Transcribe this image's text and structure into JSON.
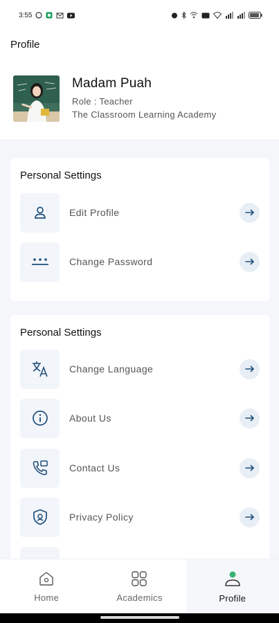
{
  "status_bar": {
    "time": "3:55",
    "left_icons": [
      "whatsapp-icon",
      "app-badge-icon",
      "mail-icon",
      "youtube-icon"
    ],
    "right_icons": [
      "alarm-icon",
      "bluetooth-icon",
      "vowifi-icon",
      "hd-icon",
      "wifi-icon",
      "signal-icon",
      "signal-icon",
      "battery-icon"
    ]
  },
  "appbar": {
    "title": "Profile"
  },
  "profile": {
    "name": "Madam Puah",
    "role": "Role : Teacher",
    "school": "The Classroom Learning Academy"
  },
  "sections": [
    {
      "title": "Personal Settings",
      "items": [
        {
          "label": "Edit Profile",
          "icon": "user-icon"
        },
        {
          "label": "Change Password",
          "icon": "password-icon"
        }
      ]
    },
    {
      "title": "Personal Settings",
      "items": [
        {
          "label": "Change Language",
          "icon": "translate-icon"
        },
        {
          "label": "About Us",
          "icon": "info-icon"
        },
        {
          "label": "Contact Us",
          "icon": "phone-icon"
        },
        {
          "label": "Privacy Policy",
          "icon": "shield-icon"
        }
      ]
    }
  ],
  "bottom_nav": [
    {
      "label": "Home",
      "icon": "home-icon",
      "active": false
    },
    {
      "label": "Academics",
      "icon": "grid-icon",
      "active": false
    },
    {
      "label": "Profile",
      "icon": "profile-icon",
      "active": true
    }
  ],
  "colors": {
    "accent": "#1f4e79",
    "active_dot": "#3bb273",
    "background": "#f4f6fa",
    "arrow_bg": "#e8eef5",
    "icon_tile": "#f2f5fa"
  }
}
